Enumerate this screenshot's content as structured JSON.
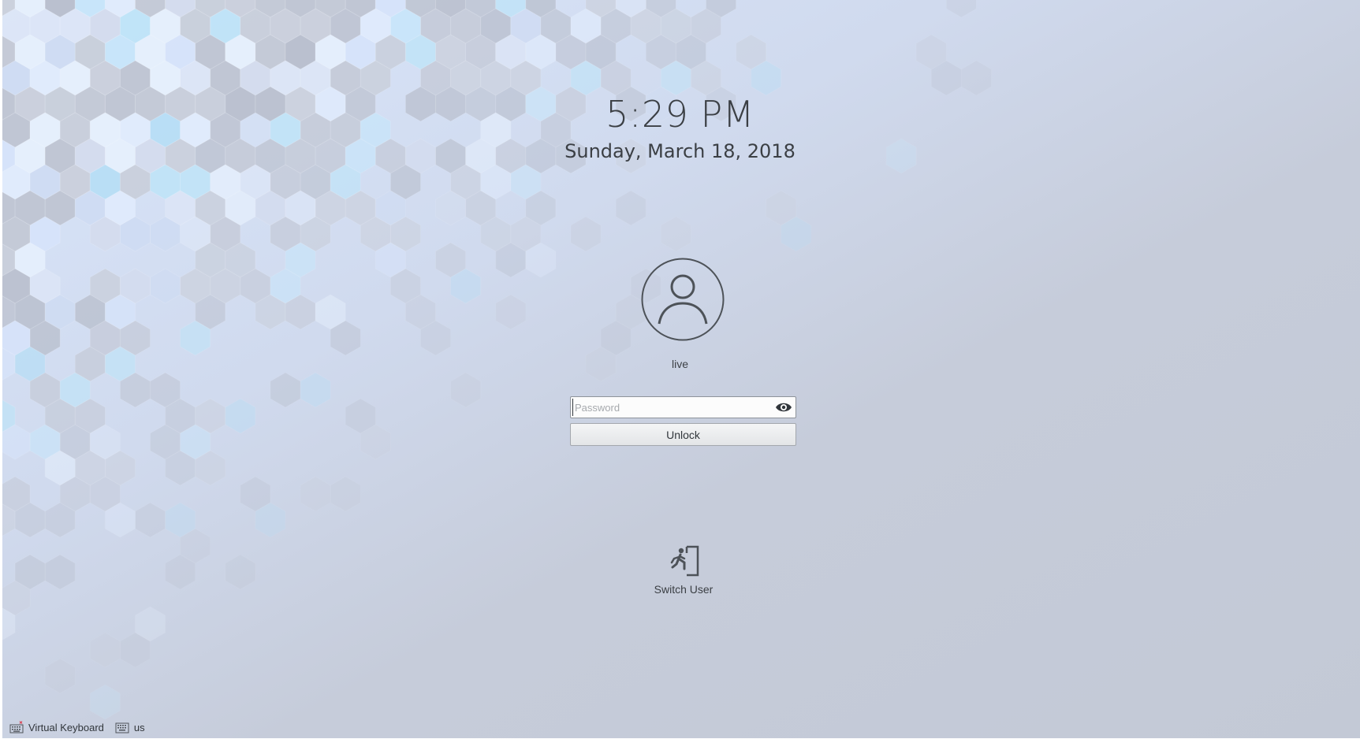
{
  "lockscreen": {
    "time": "5:29 PM",
    "date": "Sunday, March 18, 2018",
    "username": "live",
    "password": {
      "placeholder": "Password",
      "value": ""
    },
    "unlock_label": "Unlock",
    "switch_user_label": "Switch User"
  },
  "bottom_bar": {
    "virtual_keyboard_label": "Virtual Keyboard",
    "keyboard_layout": "us"
  },
  "icons": {
    "avatar": "user-avatar-icon",
    "reveal": "eye-icon",
    "switch_user": "switch-user-icon",
    "virtual_keyboard": "keyboard-icon",
    "layout": "keyboard-layout-icon"
  },
  "colors": {
    "text": "#3b3f44",
    "background": "#c4cad8",
    "accent_hex": "#bfe4f8"
  }
}
